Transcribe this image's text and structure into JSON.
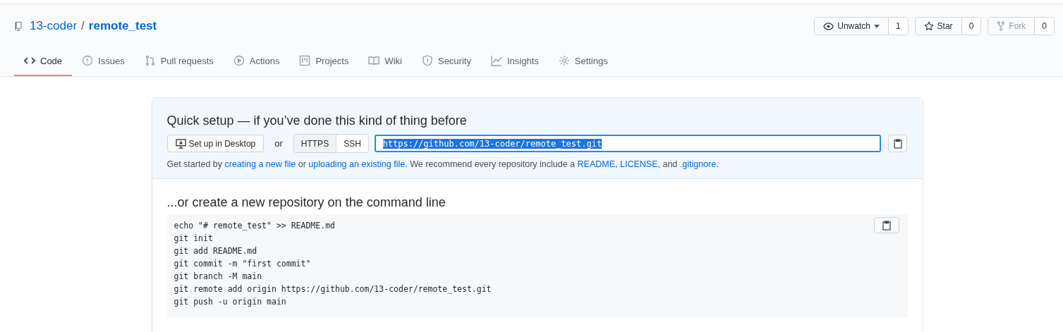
{
  "repo": {
    "owner": "13-coder",
    "separator": "/",
    "name": "remote_test"
  },
  "actions": [
    {
      "label": "Unwatch",
      "count": "1",
      "disabled": false,
      "dropdown": true
    },
    {
      "label": "Star",
      "count": "0",
      "disabled": false,
      "dropdown": false
    },
    {
      "label": "Fork",
      "count": "0",
      "disabled": true,
      "dropdown": false
    }
  ],
  "tabs": [
    {
      "label": "Code",
      "selected": true
    },
    {
      "label": "Issues",
      "selected": false
    },
    {
      "label": "Pull requests",
      "selected": false
    },
    {
      "label": "Actions",
      "selected": false
    },
    {
      "label": "Projects",
      "selected": false
    },
    {
      "label": "Wiki",
      "selected": false
    },
    {
      "label": "Security",
      "selected": false
    },
    {
      "label": "Insights",
      "selected": false
    },
    {
      "label": "Settings",
      "selected": false
    }
  ],
  "quick_setup": {
    "title": "Quick setup — if you’ve done this kind of thing before",
    "desktop_button": "Set up in Desktop",
    "or": "or",
    "protocols": [
      {
        "label": "HTTPS",
        "selected": true
      },
      {
        "label": "SSH",
        "selected": false
      }
    ],
    "url": "https://github.com/13-coder/remote_test.git",
    "hint": [
      {
        "kind": "text",
        "text": "Get started by "
      },
      {
        "kind": "link",
        "text": "creating a new file"
      },
      {
        "kind": "text",
        "text": " or "
      },
      {
        "kind": "link",
        "text": "uploading an existing file"
      },
      {
        "kind": "text",
        "text": ". We recommend every repository include a "
      },
      {
        "kind": "link",
        "text": "README"
      },
      {
        "kind": "text",
        "text": ", "
      },
      {
        "kind": "link",
        "text": "LICENSE"
      },
      {
        "kind": "text",
        "text": ", and "
      },
      {
        "kind": "link",
        "text": ".gitignore"
      },
      {
        "kind": "text",
        "text": "."
      }
    ]
  },
  "command_line": {
    "title": "...or create a new repository on the command line",
    "lines": [
      "echo \"# remote_test\" >> README.md",
      "git init",
      "git add README.md",
      "git commit -m \"first commit\"",
      "git branch -M main",
      "git remote add origin https://github.com/13-coder/remote_test.git",
      "git push -u origin main"
    ]
  }
}
